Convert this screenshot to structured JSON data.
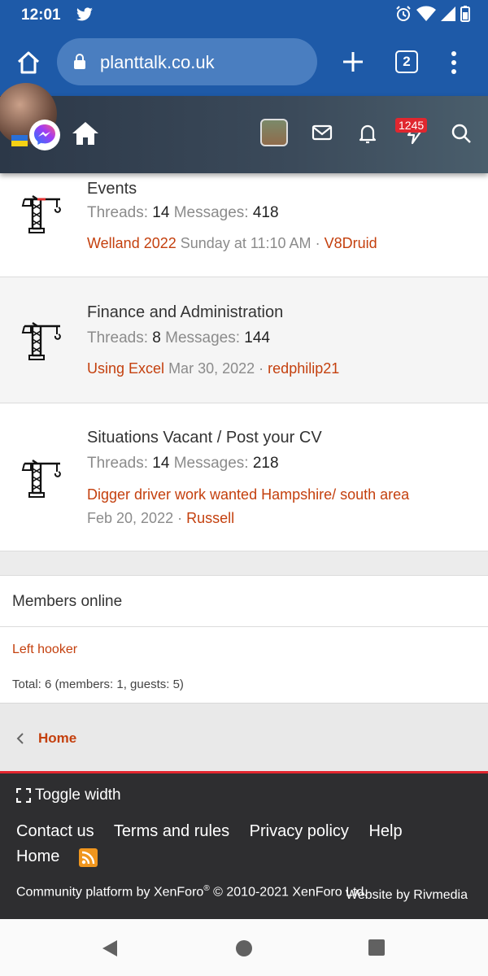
{
  "status_bar": {
    "time": "12:01"
  },
  "browser": {
    "url": "planttalk.co.uk",
    "tab_count": "2"
  },
  "forum_header": {
    "notification_count": "1245"
  },
  "nodes": [
    {
      "title": "Events",
      "threads_label": "Threads:",
      "threads": "14",
      "messages_label": "Messages:",
      "messages": "418",
      "last_post_title": "Welland 2022",
      "last_post_date": "Sunday at 11:10 AM",
      "separator": "·",
      "last_post_user": "V8Druid"
    },
    {
      "title": "Finance and Administration",
      "threads_label": "Threads:",
      "threads": "8",
      "messages_label": "Messages:",
      "messages": "144",
      "last_post_title": "Using Excel",
      "last_post_date": "Mar 30, 2022",
      "separator": "·",
      "last_post_user": "redphilip21"
    },
    {
      "title": "Situations Vacant / Post your CV",
      "threads_label": "Threads:",
      "threads": "14",
      "messages_label": "Messages:",
      "messages": "218",
      "last_post_title": "Digger driver work wanted Hampshire/ south area",
      "last_post_date": "Feb 20, 2022",
      "separator": "·",
      "last_post_user": "Russell"
    }
  ],
  "members_online": {
    "title": "Members online",
    "members": [
      "Left hooker"
    ],
    "total": "Total: 6 (members: 1, guests: 5)"
  },
  "breadcrumb": {
    "home": "Home"
  },
  "footer": {
    "toggle_width": "Toggle width",
    "links": [
      "Contact us",
      "Terms and rules",
      "Privacy policy",
      "Help"
    ],
    "home": "Home",
    "copyright_prefix": "Community platform by XenForo",
    "copyright_sup": "®",
    "copyright_suffix": " © 2010-2021 XenForo Ltd.",
    "website_by": "Website by Rivmedia"
  },
  "colors": {
    "link": "#c4400e",
    "browser_bar": "#1e5aa8",
    "footer": "#2e2e30",
    "accent_red": "#e2262e"
  }
}
